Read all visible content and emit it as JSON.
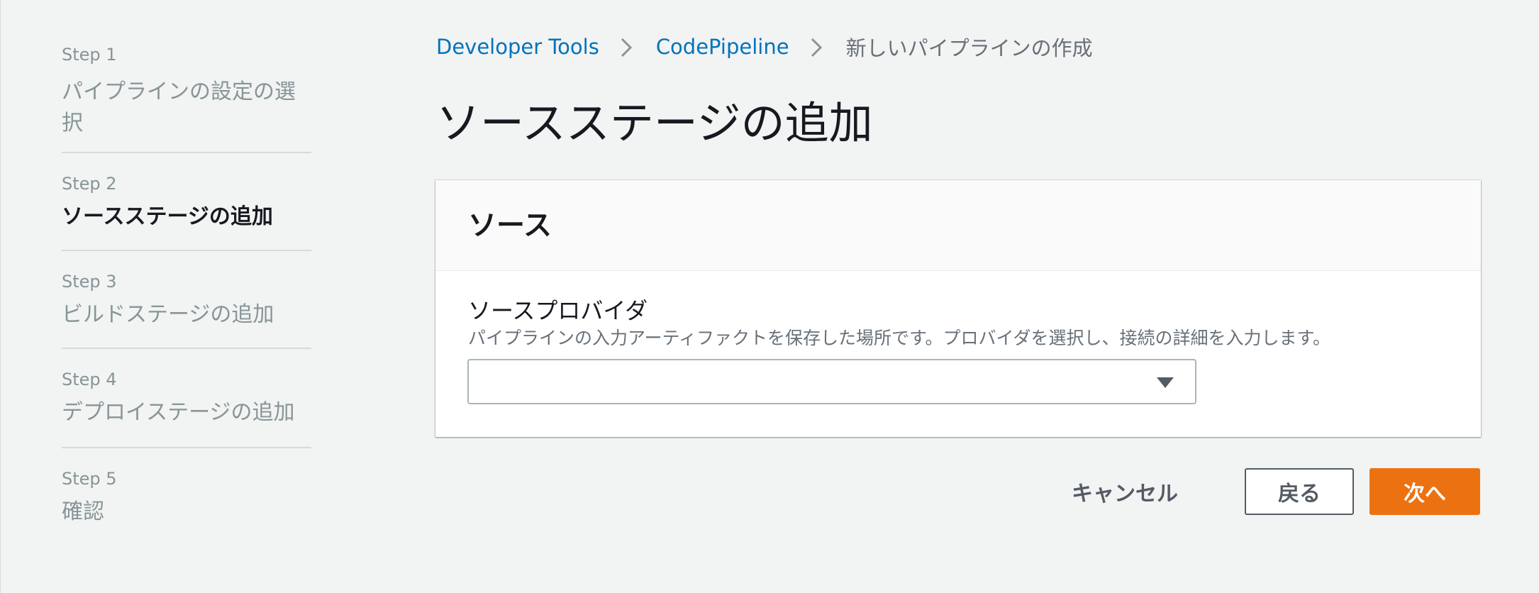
{
  "wizard_nav": {
    "steps": [
      {
        "number": "Step 1",
        "title": "パイプラインの設定の選択",
        "state": "done"
      },
      {
        "number": "Step 2",
        "title": "ソースステージの追加",
        "state": "active"
      },
      {
        "number": "Step 3",
        "title": "ビルドステージの追加",
        "state": "pending"
      },
      {
        "number": "Step 4",
        "title": "デプロイステージの追加",
        "state": "pending"
      },
      {
        "number": "Step 5",
        "title": "確認",
        "state": "pending"
      }
    ]
  },
  "breadcrumb": {
    "items": [
      "Developer Tools",
      "CodePipeline",
      "新しいパイプラインの作成"
    ]
  },
  "page": {
    "title": "ソースステージの追加"
  },
  "source_panel": {
    "header": "ソース",
    "provider_field": {
      "label": "ソースプロバイダ",
      "description": "パイプラインの入力アーティファクトを保存した場所です。プロバイダを選択し、接続の詳細を入力します。",
      "value": ""
    }
  },
  "actions": {
    "cancel_label": "キャンセル",
    "previous_label": "戻る",
    "next_label": "次へ"
  },
  "colors": {
    "link": "#0073bb",
    "primary_button": "#ec7211",
    "muted_text": "#879596",
    "background": "#f2f3f3"
  }
}
